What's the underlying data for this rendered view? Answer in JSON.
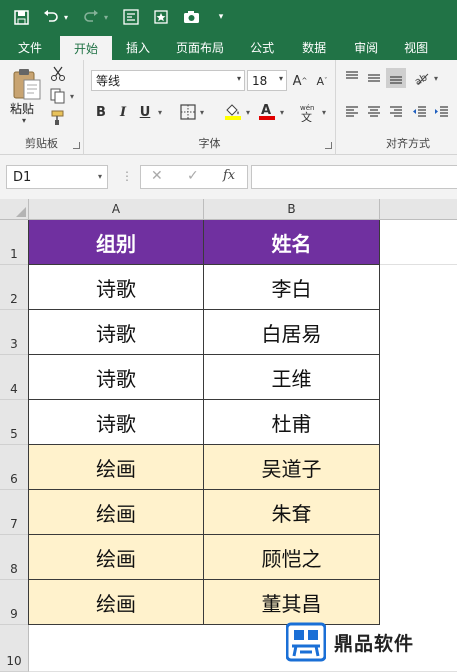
{
  "ribbon_tabs": [
    "文件",
    "开始",
    "插入",
    "页面布局",
    "公式",
    "数据",
    "审阅",
    "视图"
  ],
  "clipboard": {
    "paste_label": "粘贴",
    "group_label": "剪贴板"
  },
  "font": {
    "name": "等线",
    "size": "18",
    "group_label": "字体"
  },
  "alignment": {
    "group_label": "对齐方式"
  },
  "formula_bar": {
    "name_box": "D1",
    "fx": "fx",
    "value": ""
  },
  "columns": [
    "A",
    "B"
  ],
  "rows": [
    "1",
    "2",
    "3",
    "4",
    "5",
    "6",
    "7",
    "8",
    "9",
    "10"
  ],
  "table": {
    "headers": [
      "组别",
      "姓名"
    ],
    "rows": [
      [
        "诗歌",
        "李白"
      ],
      [
        "诗歌",
        "白居易"
      ],
      [
        "诗歌",
        "王维"
      ],
      [
        "诗歌",
        "杜甫"
      ],
      [
        "绘画",
        "吴道子"
      ],
      [
        "绘画",
        "朱耷"
      ],
      [
        "绘画",
        "顾恺之"
      ],
      [
        "绘画",
        "董其昌"
      ]
    ]
  },
  "colors": {
    "header_fill": "#7030a0",
    "yellow_fill": "#fff2cc",
    "excel_green": "#217346",
    "watermark_blue": "#1a6fd6"
  },
  "watermark": {
    "text": "鼎品软件"
  }
}
